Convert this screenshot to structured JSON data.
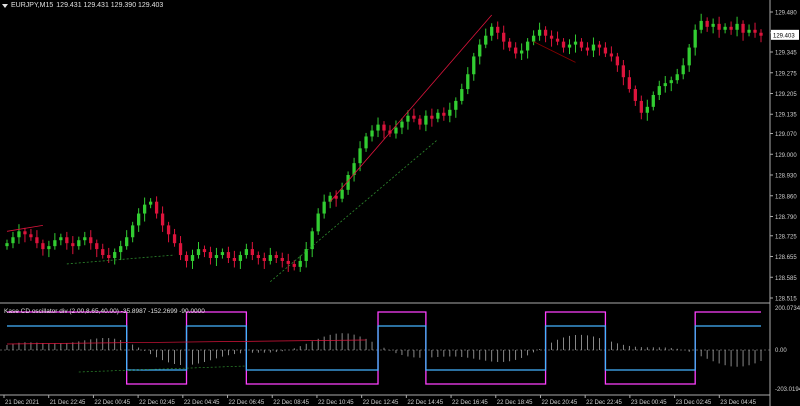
{
  "window": {
    "symbol_label": "EURJPY,M15",
    "ohlc": "129.431 129.431 129.390 129.403",
    "current_price": "129.403"
  },
  "indicator": {
    "title": "Kase CD oscillator div (2.00,8.65,40.00) -35.8987 -152.2699 -90.0000",
    "scale_labels": [
      "200.0734",
      "0.00",
      "-203.0194"
    ]
  },
  "colors": {
    "background": "#000000",
    "bull": "#32cd32",
    "bear": "#dc143c",
    "grid": "#444444",
    "magenta": "#ff40ff",
    "cyan": "#45b4ff"
  },
  "chart_data": {
    "type": "candlestick",
    "y_ticks": [
      "129.480",
      "129.345",
      "129.205",
      "129.070",
      "129.000",
      "128.860",
      "128.725",
      "128.655",
      "128.515"
    ],
    "ylim": [
      128.515,
      129.48
    ],
    "x_ticks": [
      "21 Dec 2021",
      "21 Dec 22:45",
      "22 Dec 00:45",
      "22 Dec 02:45",
      "22 Dec 04:45",
      "22 Dec 06:45",
      "22 Dec 08:45",
      "22 Dec 10:45",
      "22 Dec 12:45",
      "22 Dec 14:45",
      "22 Dec 16:45",
      "22 Dec 18:45",
      "22 Dec 20:45",
      "22 Dec 22:45",
      "23 Dec 00:45",
      "23 Dec 02:45",
      "23 Dec 04:45"
    ],
    "y_tick_values": [
      129.48,
      129.41,
      129.345,
      129.275,
      129.205,
      129.135,
      129.07,
      129.0,
      128.93,
      128.86,
      128.79,
      128.725,
      128.655,
      128.585,
      128.515
    ],
    "y_tick_labels": [
      "129.480",
      "129.410",
      "129.345",
      "129.275",
      "129.205",
      "129.135",
      "129.070",
      "129.000",
      "128.930",
      "128.860",
      "128.790",
      "128.725",
      "128.655",
      "128.585",
      "128.515"
    ],
    "closes": [
      128.7,
      128.72,
      128.74,
      128.73,
      128.72,
      128.7,
      128.68,
      128.69,
      128.71,
      128.72,
      128.7,
      128.69,
      128.71,
      128.72,
      128.7,
      128.68,
      128.66,
      128.65,
      128.67,
      128.69,
      128.72,
      128.76,
      128.8,
      128.83,
      128.84,
      128.8,
      128.76,
      128.73,
      128.7,
      128.66,
      128.64,
      128.66,
      128.68,
      128.67,
      128.65,
      128.66,
      128.67,
      128.65,
      128.64,
      128.66,
      128.68,
      128.66,
      128.65,
      128.64,
      128.66,
      128.65,
      128.64,
      128.63,
      128.62,
      128.64,
      128.68,
      128.74,
      128.8,
      128.84,
      128.86,
      128.85,
      128.88,
      128.93,
      128.97,
      129.02,
      129.06,
      129.08,
      129.1,
      129.08,
      129.07,
      129.09,
      129.11,
      129.13,
      129.12,
      129.1,
      129.13,
      129.12,
      129.14,
      129.13,
      129.15,
      129.18,
      129.22,
      129.27,
      129.33,
      129.37,
      129.4,
      129.43,
      129.41,
      129.38,
      129.36,
      129.34,
      129.35,
      129.38,
      129.4,
      129.42,
      129.4,
      129.39,
      129.38,
      129.36,
      129.37,
      129.38,
      129.36,
      129.35,
      129.37,
      129.36,
      129.34,
      129.33,
      129.3,
      129.26,
      129.22,
      129.18,
      129.14,
      129.16,
      129.2,
      129.23,
      129.24,
      129.25,
      129.27,
      129.3,
      129.36,
      129.42,
      129.45,
      129.43,
      129.44,
      129.42,
      129.43,
      129.42,
      129.44,
      129.41,
      129.42,
      129.41,
      129.4
    ]
  }
}
